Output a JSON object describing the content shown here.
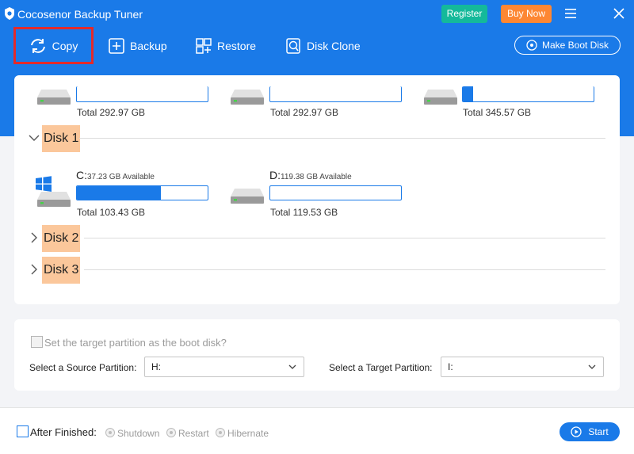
{
  "app": {
    "title": "Cocosenor Backup Tuner",
    "register_label": "Register",
    "buy_label": "Buy Now"
  },
  "toolbar": {
    "copy_label": "Copy",
    "backup_label": "Backup",
    "restore_label": "Restore",
    "clone_label": "Disk Clone",
    "boot_label": "Make Boot Disk"
  },
  "disk0": {
    "drives": [
      {
        "total": "Total 292.97 GB",
        "used_fraction": 0
      },
      {
        "total": "Total 292.97 GB",
        "used_fraction": 0
      },
      {
        "total": "Total 345.57 GB",
        "used_fraction": 0.08
      }
    ]
  },
  "disk1": {
    "label": "Disk 1",
    "partitions": [
      {
        "letter": "C:",
        "available": "37.23 GB Available",
        "total": "Total 103.43 GB",
        "used_fraction": 0.64
      },
      {
        "letter": "D:",
        "available": "119.38 GB Available",
        "total": "Total 119.53 GB",
        "used_fraction": 0.0
      }
    ]
  },
  "disk2": {
    "label": "Disk 2"
  },
  "disk3": {
    "label": "Disk 3"
  },
  "options": {
    "boot_checkbox_label": "Set the target partition as the boot disk?",
    "source_label": "Select a Source Partition:",
    "source_value": "H:",
    "target_label": "Select a Target Partition:",
    "target_value": "I:"
  },
  "bottom": {
    "after_label": "After Finished:",
    "radios": [
      "Shutdown",
      "Restart",
      "Hibernate"
    ],
    "start_label": "Start"
  },
  "colors": {
    "accent": "#1a7ae8",
    "register": "#14b99a",
    "buy": "#fd8733",
    "highlight": "#fbc79b",
    "selection_outline": "#e32a2a"
  }
}
